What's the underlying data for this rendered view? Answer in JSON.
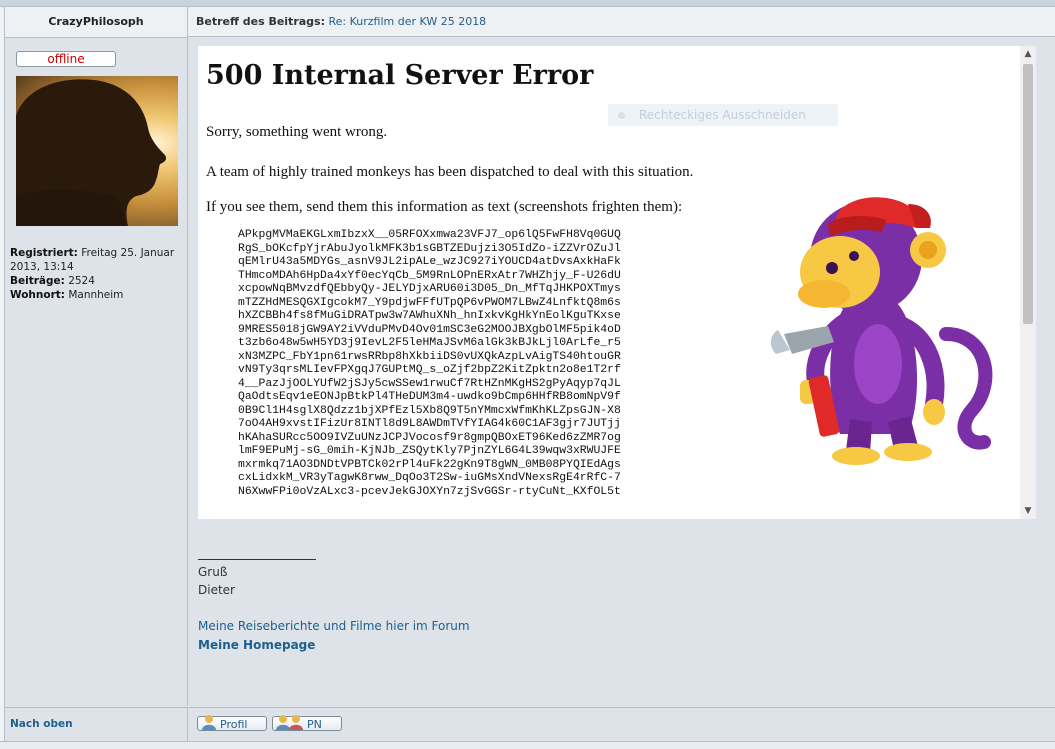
{
  "post": {
    "author": "CrazyPhilosoph",
    "subject_label": "Betreff des Beitrags:",
    "subject": "Re: Kurzfilm der KW 25 2018",
    "status_button": "offline",
    "user_info": [
      {
        "label": "Registriert:",
        "value": "Freitag 25. Januar 2013, 13:14"
      },
      {
        "label": "Beiträge:",
        "value": "2524"
      },
      {
        "label": "Wohnort:",
        "value": "Mannheim"
      }
    ]
  },
  "error_page": {
    "title": "500 Internal Server Error",
    "line1": "Sorry, something went wrong.",
    "line2": "A team of highly trained monkeys has been dispatched to deal with this situation.",
    "line3": "If you see them, send them this information as text (screenshots frighten them):",
    "overlay_text": "Rechteckiges Ausschneiden",
    "code_lines": [
      "APkpgMVMaEKGLxmIbzxX__05RFOXxmwa23VFJ7_op6lQ5FwFH8Vq0GUQ",
      "RgS_bOKcfpYjrAbuJyolkMFK3b1sGBTZEDujzi3O5IdZo-iZZVrOZuJl",
      "qEMlrU43a5MDYGs_asnV9JL2ipALe_wzJC927iYOUCD4atDvsAxkHaFk",
      "THmcoMDAh6HpDa4xYf0ecYqCb_5M9RnLOPnERxAtr7WHZhjy_F-U26dU",
      "xcpowNqBMvzdfQEbbyQy-JELYDjxARU60i3D05_Dn_MfTqJHKPOXTmys",
      "mTZZHdMESQGXIgcokM7_Y9pdjwFFfUTpQP6vPWOM7LBwZ4LnfktQ8m6s",
      "hXZCBBh4fs8fMuGiDRATpw3w7AWhuXNh_hnIxkvKgHkYnEolKguTKxse",
      "9MRES5018jGW9AY2iVVduPMvD4Ov01mSC3eG2MOOJBXgbOlMF5pik4oD",
      "t3zb6o48w5wH5YD3j9IevL2F5leHMaJSvM6alGk3kBJkLjl0ArLfe_r5",
      "xN3MZPC_FbY1pn61rwsRRbp8hXkbiiDS0vUXQkAzpLvAigTS40htouGR",
      "vN9Ty3qrsMLIevFPXgqJ7GUPtMQ_s_oZjf2bpZ2KitZpktn2o8e1T2rf",
      "4__PazJjOOLYUfW2jSJy5cwSSew1rwuCf7RtHZnMKgHS2gPyAqyp7qJL",
      "QaOdtsEqv1eEONJpBtkPl4THeDUM3m4-uwdko9bCmp6HHfRB8omNpV9f",
      "0B9Cl1H4sglX8Qdzz1bjXPfEzl5Xb8Q9T5nYMmcxWfmKhKLZpsGJN-X8",
      "7oO4AH9xvstIFizUr8INTl8d9L8AWDmTVfYIAG4k60C1AF3gjr7JUTjj",
      "hKAhaSURcc5OO9IVZuUNzJCPJVocosf9r8gmpQBOxET96Ked6zZMR7og",
      "lmF9EPuMj-sG_0mih-KjNJb_ZSQytKly7PjnZYL6G4L39wqw3xRWUJFE",
      "mxrmkq71AO3DNDtVPBTCk02rPl4uFk22gKn9T8gWN_0MB08PYQIEdAgs",
      "cxLidxkM_VR3yTagwK8rww_DqOo3T2Sw-iuGMsXndVNexsRgE4rRfC-7",
      "N6XwwFPi0oVzALxc3-pcevJekGJOXYn7zjSvGGSr-rtyCuNt_KXfOL5t"
    ]
  },
  "signature": {
    "line1": "Gruß",
    "line2": "Dieter",
    "link1": "Meine Reiseberichte und Filme hier im Forum",
    "link2": "Meine Homepage"
  },
  "footer": {
    "back_to_top": "Nach oben",
    "profile_button": "Profil",
    "pm_button": "PN"
  },
  "colors": {
    "link": "#1f5f8b",
    "offline": "#cc0000",
    "panel": "#dde3e9"
  }
}
